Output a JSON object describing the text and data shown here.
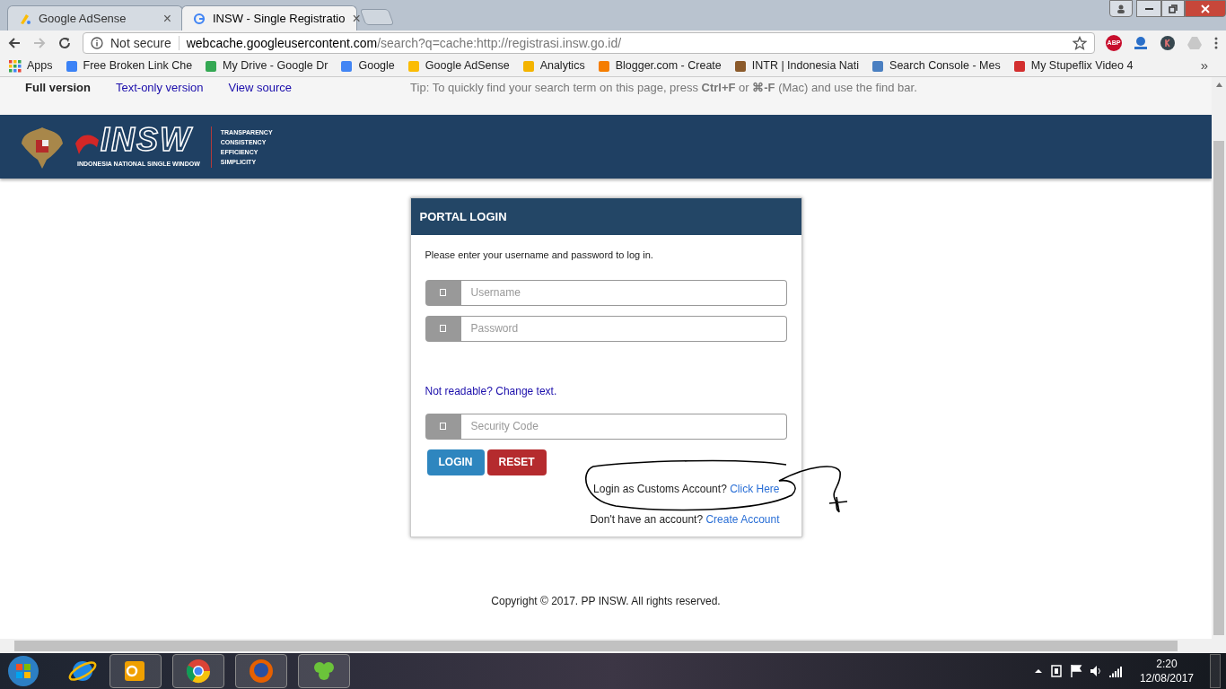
{
  "browser": {
    "tabs": [
      {
        "title": "Google AdSense",
        "selected": false
      },
      {
        "title": "INSW - Single Registratio",
        "selected": true
      }
    ],
    "close_glyph": "×",
    "address": {
      "security": "Not secure",
      "host": "webcache.googleusercontent.com",
      "path": "/search?q=cache:http://registrasi.insw.go.id/"
    },
    "extensions": [
      "ABP"
    ],
    "bookmarks": [
      {
        "label": "Apps"
      },
      {
        "label": "Free Broken Link Che"
      },
      {
        "label": "My Drive - Google Dr"
      },
      {
        "label": "Google"
      },
      {
        "label": "Google AdSense"
      },
      {
        "label": "Analytics"
      },
      {
        "label": "Blogger.com - Create"
      },
      {
        "label": "INTR | Indonesia Nati"
      },
      {
        "label": "Search Console - Mes"
      },
      {
        "label": "My Stupeflix Video 4"
      }
    ],
    "bookmarks_overflow": "»"
  },
  "cache_bar": {
    "links": [
      {
        "label": "Full version",
        "selected": true
      },
      {
        "label": "Text-only version",
        "selected": false
      },
      {
        "label": "View source",
        "selected": false
      }
    ],
    "tip": "Tip: To quickly find your search term on this page, press **Ctrl+F** or **⌘-F** (Mac) and use the find bar."
  },
  "header": {
    "logo": "INSW",
    "subtitle": "INDONESIA NATIONAL SINGLE WINDOW",
    "taglines": [
      "TRANSPARENCY",
      "CONSISTENCY",
      "EFFICIENCY",
      "SIMPLICITY"
    ]
  },
  "login": {
    "title": "PORTAL LOGIN",
    "instruction": "Please enter your username and password to log in.",
    "fields": [
      {
        "placeholder": "Username"
      },
      {
        "placeholder": "Password"
      }
    ],
    "captcha_link": "Not readable? Change text.",
    "security_field": {
      "placeholder": "Security Code"
    },
    "buttons": [
      {
        "label": "LOGIN",
        "kind": "primary"
      },
      {
        "label": "RESET",
        "kind": "danger"
      }
    ],
    "customs": {
      "text": "Login as Customs Account?",
      "link": "Click Here"
    },
    "signup": {
      "text": "Don't have an account?",
      "link": "Create Account"
    }
  },
  "footer": "Copyright © 2017. PP INSW. All rights reserved.",
  "taskbar": {
    "time": "2:20",
    "date": "12/08/2017"
  }
}
